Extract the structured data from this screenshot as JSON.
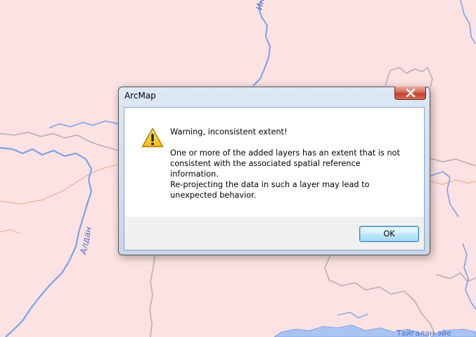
{
  "map": {
    "river_label_top": "Ин",
    "river_label_left": "Алдан",
    "lake_label": "Тайгалан-эйе",
    "colors": {
      "background": "#fce2e2",
      "river": "#7da2e8",
      "border": "#b8b0b6",
      "road": "#f2b8a2",
      "water": "#aac4f2"
    }
  },
  "dialog": {
    "title": "ArcMap",
    "close_icon": "close-icon",
    "warning_icon": "warning-triangle-icon",
    "heading": "Warning, inconsistent extent!",
    "body_1": "One or more of the added layers has an extent that is not consistent with the associated spatial reference information.",
    "body_2": "Re-projecting the data in such a layer may lead to unexpected behavior.",
    "ok_label": "OK"
  }
}
